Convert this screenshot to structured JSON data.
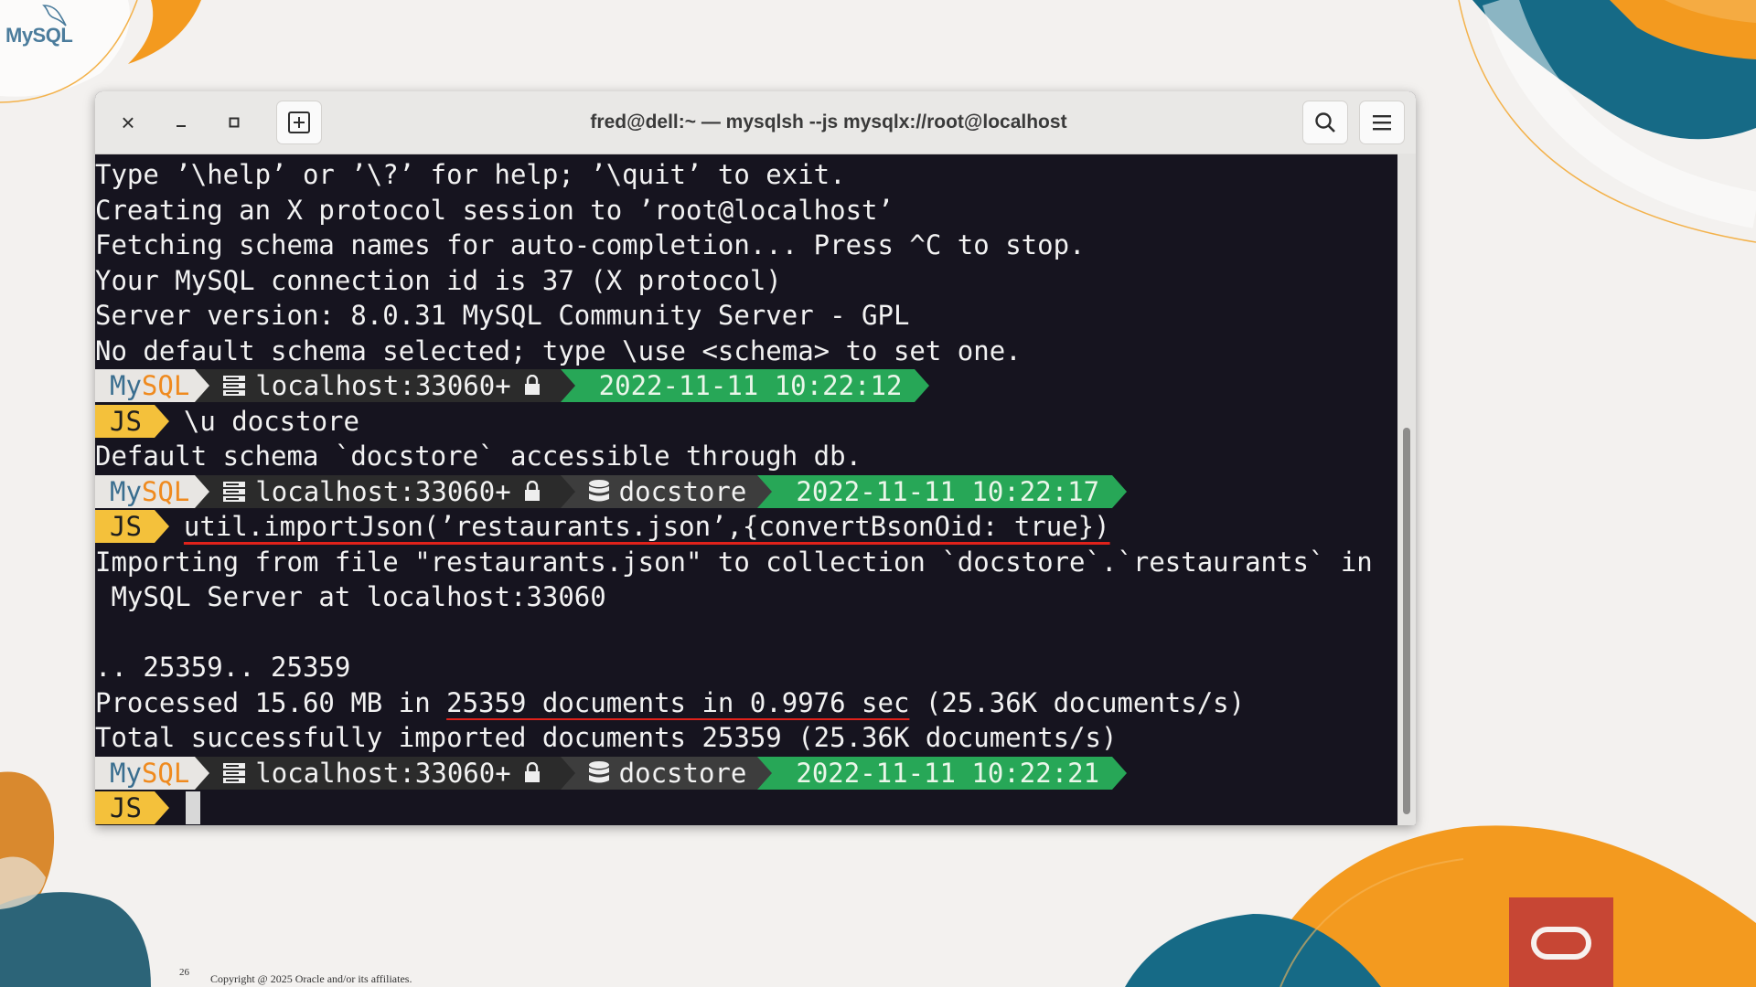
{
  "brand": {
    "logo_text": "MySQL"
  },
  "window": {
    "title": "fred@dell:~ — mysqlsh --js mysqlx://root@localhost",
    "buttons": {
      "close": "×",
      "minimize": "–",
      "maximize": "◻"
    }
  },
  "terminal": {
    "intro_lines": [
      "Type ’\\help’ or ’\\?’ for help; ’\\quit’ to exit.",
      "Creating an X protocol session to ’root@localhost’",
      "Fetching schema names for auto-completion... Press ^C to stop.",
      "Your MySQL connection id is 37 (X protocol)",
      "Server version: 8.0.31 MySQL Community Server - GPL",
      "No default schema selected; type \\use <schema> to set one."
    ],
    "prompt1": {
      "mysql_a": "My",
      "mysql_b": "SQL",
      "host": "localhost:33060+",
      "time": "2022-11-11 10:22:12"
    },
    "js_label": "JS",
    "cmd1": "\\u docstore",
    "out1": "Default schema `docstore` accessible through db.",
    "prompt2": {
      "mysql_a": "My",
      "mysql_b": "SQL",
      "host": "localhost:33060+",
      "schema": "docstore",
      "time": "2022-11-11 10:22:17"
    },
    "cmd2": "util.importJson(’restaurants.json’,{convertBsonOid: true})",
    "out2_line1": "Importing from file \"restaurants.json\" to collection `docstore`.`restaurants` in",
    "out2_line2": " MySQL Server at localhost:33060",
    "out2_line3": "",
    "out2_line4": ".. 25359.. 25359",
    "processed_pre": "Processed 15.60 MB in ",
    "processed_hl": "25359 documents in 0.9976 sec",
    "processed_post": " (25.36K documents/s)",
    "total_line": "Total successfully imported documents 25359 (25.36K documents/s)",
    "prompt3": {
      "mysql_a": "My",
      "mysql_b": "SQL",
      "host": "localhost:33060+",
      "schema": "docstore",
      "time": "2022-11-11 10:22:21"
    }
  },
  "footer": {
    "page_number": "26",
    "copyright": "Copyright @ 2025 Oracle and/or its affiliates."
  },
  "colors": {
    "accent_orange": "#f39a1f",
    "teal": "#166a86",
    "oracle_red": "#c74634",
    "prompt_green": "#27a757",
    "js_yellow": "#f4c13b"
  }
}
